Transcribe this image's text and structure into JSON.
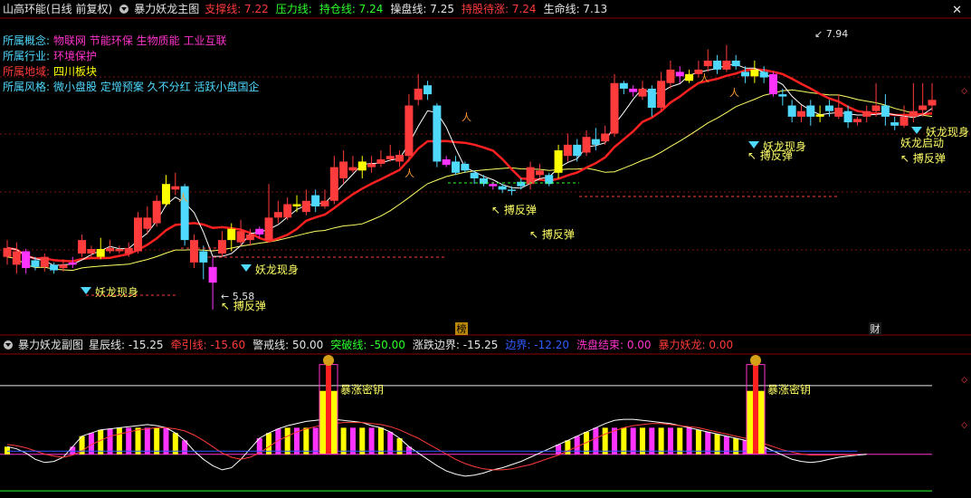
{
  "main_header": {
    "stock": "山高环能(日线 前复权)",
    "indicator": "暴力妖龙主图",
    "items": [
      {
        "label": "支撑线:",
        "value": "7.22",
        "color": "#ff3b3b"
      },
      {
        "label": "压力线:",
        "value": "",
        "color": "#2bff2b"
      },
      {
        "label": "持仓线:",
        "value": "7.24",
        "color": "#2bff2b"
      },
      {
        "label": "操盘线:",
        "value": "7.25",
        "color": "#e6e6e6"
      },
      {
        "label": "持股待涨:",
        "value": "7.24",
        "color": "#ff3b3b"
      },
      {
        "label": "生命线:",
        "value": "7.13",
        "color": "#e6e6e6"
      }
    ]
  },
  "info_panel": [
    {
      "label": "所属概念:",
      "value": "物联网 节能环保 生物质能 工业互联",
      "label_color": "#4fd9ff",
      "value_color": "#ff33cc"
    },
    {
      "label": "所属行业:",
      "value": "环境保护",
      "label_color": "#4fd9ff",
      "value_color": "#ff33cc"
    },
    {
      "label": "所属地域:",
      "value": "四川板块",
      "label_color": "#ff3b3b",
      "value_color": "#ffff00"
    },
    {
      "label": "所属风格:",
      "value": "微小盘股 定增预案 久不分红 活跃小盘国企",
      "label_color": "#4fd9ff",
      "value_color": "#4fd9ff"
    }
  ],
  "sub_header": {
    "indicator": "暴力妖龙副图",
    "items": [
      {
        "label": "星辰线:",
        "value": "-15.25",
        "color": "#e6e6e6"
      },
      {
        "label": "牵引线:",
        "value": "-15.60",
        "color": "#ff3b3b"
      },
      {
        "label": "警戒线:",
        "value": "50.00",
        "color": "#e6e6e6"
      },
      {
        "label": "突破线:",
        "value": "-50.00",
        "color": "#2bff2b"
      },
      {
        "label": "涨跌边界:",
        "value": "-15.25",
        "color": "#e6e6e6"
      },
      {
        "label": "边界:",
        "value": "-12.20",
        "color": "#2f5bff"
      },
      {
        "label": "洗盘结束:",
        "value": "0.00",
        "color": "#ff33cc"
      },
      {
        "label": "暴力妖龙:",
        "value": "0.00",
        "color": "#ff3b3b"
      }
    ]
  },
  "chart_data": [
    {
      "type": "candlestick",
      "title": "暴力妖龙主图",
      "annotations": {
        "high_label": "7.94",
        "low_label": "5.58",
        "signals": [
          "妖龙现身",
          "妖龙现身",
          "妖龙现身",
          "妖龙现身",
          "妖龙启动"
        ],
        "rebounds": [
          "搏反弹",
          "搏反弹",
          "搏反弹",
          "搏反弹",
          "搏反弹"
        ],
        "markers": [
          "榜",
          "财"
        ]
      },
      "candles": [
        {
          "o": 6.05,
          "c": 6.13,
          "h": 6.2,
          "l": 5.98
        },
        {
          "o": 5.98,
          "c": 6.1,
          "h": 6.18,
          "l": 5.9
        },
        {
          "o": 6.1,
          "c": 5.95,
          "h": 6.12,
          "l": 5.9
        },
        {
          "o": 6.02,
          "c": 5.96,
          "h": 6.05,
          "l": 5.93
        },
        {
          "o": 5.96,
          "c": 6.05,
          "h": 6.08,
          "l": 5.92
        },
        {
          "o": 5.98,
          "c": 5.93,
          "h": 6.0,
          "l": 5.9
        },
        {
          "o": 5.95,
          "c": 5.98,
          "h": 6.03,
          "l": 5.92
        },
        {
          "o": 6.0,
          "c": 5.98,
          "h": 6.05,
          "l": 5.95
        },
        {
          "o": 6.08,
          "c": 6.2,
          "h": 6.25,
          "l": 6.05
        },
        {
          "o": 6.08,
          "c": 6.12,
          "h": 6.15,
          "l": 6.05
        },
        {
          "o": 6.05,
          "c": 6.12,
          "h": 6.22,
          "l": 6.03
        },
        {
          "o": 6.1,
          "c": 6.13,
          "h": 6.2,
          "l": 6.08
        },
        {
          "o": 6.1,
          "c": 6.12,
          "h": 6.15,
          "l": 6.08
        },
        {
          "o": 6.08,
          "c": 6.13,
          "h": 6.18,
          "l": 6.05
        },
        {
          "o": 6.1,
          "c": 6.4,
          "h": 6.45,
          "l": 6.08
        },
        {
          "o": 6.3,
          "c": 6.4,
          "h": 6.5,
          "l": 6.25
        },
        {
          "o": 6.35,
          "c": 6.55,
          "h": 6.6,
          "l": 6.32
        },
        {
          "o": 6.52,
          "c": 6.7,
          "h": 6.78,
          "l": 6.5
        },
        {
          "o": 6.65,
          "c": 6.68,
          "h": 6.8,
          "l": 6.6
        },
        {
          "o": 6.68,
          "c": 6.2,
          "h": 6.7,
          "l": 6.15
        },
        {
          "o": 6.0,
          "c": 6.2,
          "h": 6.25,
          "l": 5.95
        },
        {
          "o": 6.1,
          "c": 6.0,
          "h": 6.15,
          "l": 5.85
        },
        {
          "o": 5.96,
          "c": 5.82,
          "h": 6.05,
          "l": 5.58
        },
        {
          "o": 6.08,
          "c": 6.2,
          "h": 6.28,
          "l": 6.05
        },
        {
          "o": 6.2,
          "c": 6.3,
          "h": 6.35,
          "l": 6.1
        },
        {
          "o": 6.18,
          "c": 6.28,
          "h": 6.38,
          "l": 6.15
        },
        {
          "o": 6.2,
          "c": 6.25,
          "h": 6.3,
          "l": 6.15
        },
        {
          "o": 6.3,
          "c": 6.25,
          "h": 6.32,
          "l": 6.22
        },
        {
          "o": 6.2,
          "c": 6.4,
          "h": 6.7,
          "l": 6.18
        },
        {
          "o": 6.4,
          "c": 6.45,
          "h": 6.55,
          "l": 6.35
        },
        {
          "o": 6.4,
          "c": 6.52,
          "h": 6.58,
          "l": 6.38
        },
        {
          "o": 6.5,
          "c": 6.52,
          "h": 6.6,
          "l": 6.45
        },
        {
          "o": 6.45,
          "c": 6.55,
          "h": 6.65,
          "l": 6.42
        },
        {
          "o": 6.6,
          "c": 6.5,
          "h": 6.65,
          "l": 6.45
        },
        {
          "o": 6.5,
          "c": 6.55,
          "h": 6.65,
          "l": 6.48
        },
        {
          "o": 6.55,
          "c": 6.85,
          "h": 6.95,
          "l": 6.52
        },
        {
          "o": 6.75,
          "c": 6.9,
          "h": 7.0,
          "l": 6.7
        },
        {
          "o": 6.82,
          "c": 6.85,
          "h": 6.95,
          "l": 6.8
        },
        {
          "o": 6.82,
          "c": 6.9,
          "h": 6.95,
          "l": 6.75
        },
        {
          "o": 6.85,
          "c": 6.88,
          "h": 6.95,
          "l": 6.8
        },
        {
          "o": 6.88,
          "c": 6.92,
          "h": 7.0,
          "l": 6.85
        },
        {
          "o": 6.92,
          "c": 6.95,
          "h": 7.05,
          "l": 6.9
        },
        {
          "o": 6.9,
          "c": 6.96,
          "h": 7.0,
          "l": 6.85
        },
        {
          "o": 6.95,
          "c": 7.4,
          "h": 7.5,
          "l": 6.9
        },
        {
          "o": 7.45,
          "c": 7.55,
          "h": 7.68,
          "l": 7.4
        },
        {
          "o": 7.58,
          "c": 7.5,
          "h": 7.62,
          "l": 7.45
        },
        {
          "o": 7.4,
          "c": 6.9,
          "h": 7.42,
          "l": 6.85
        },
        {
          "o": 6.92,
          "c": 6.87,
          "h": 6.95,
          "l": 6.85
        },
        {
          "o": 6.9,
          "c": 6.8,
          "h": 6.95,
          "l": 6.78
        },
        {
          "o": 6.88,
          "c": 6.82,
          "h": 6.9,
          "l": 6.8
        },
        {
          "o": 6.8,
          "c": 6.75,
          "h": 6.82,
          "l": 6.7
        },
        {
          "o": 6.75,
          "c": 6.7,
          "h": 6.78,
          "l": 6.68
        },
        {
          "o": 6.7,
          "c": 6.68,
          "h": 6.72,
          "l": 6.65
        },
        {
          "o": 6.68,
          "c": 6.65,
          "h": 6.7,
          "l": 6.62
        },
        {
          "o": 6.65,
          "c": 6.64,
          "h": 6.68,
          "l": 6.6
        },
        {
          "o": 6.72,
          "c": 6.68,
          "h": 6.75,
          "l": 6.65
        },
        {
          "o": 6.7,
          "c": 6.85,
          "h": 6.9,
          "l": 6.65
        },
        {
          "o": 6.78,
          "c": 6.82,
          "h": 6.88,
          "l": 6.75
        },
        {
          "o": 6.78,
          "c": 6.7,
          "h": 6.8,
          "l": 6.68
        },
        {
          "o": 6.8,
          "c": 7.0,
          "h": 7.05,
          "l": 6.75
        },
        {
          "o": 6.95,
          "c": 7.05,
          "h": 7.15,
          "l": 6.9
        },
        {
          "o": 7.05,
          "c": 6.95,
          "h": 7.1,
          "l": 6.9
        },
        {
          "o": 6.98,
          "c": 7.12,
          "h": 7.18,
          "l": 6.95
        },
        {
          "o": 7.1,
          "c": 7.05,
          "h": 7.2,
          "l": 7.0
        },
        {
          "o": 7.08,
          "c": 7.15,
          "h": 7.22,
          "l": 7.05
        },
        {
          "o": 7.15,
          "c": 7.6,
          "h": 7.68,
          "l": 7.12
        },
        {
          "o": 7.6,
          "c": 7.55,
          "h": 7.62,
          "l": 7.5
        },
        {
          "o": 7.55,
          "c": 7.52,
          "h": 7.58,
          "l": 7.48
        },
        {
          "o": 7.48,
          "c": 7.55,
          "h": 7.62,
          "l": 7.45
        },
        {
          "o": 7.55,
          "c": 7.38,
          "h": 7.58,
          "l": 7.3
        },
        {
          "o": 7.38,
          "c": 7.62,
          "h": 7.7,
          "l": 7.35
        },
        {
          "o": 7.6,
          "c": 7.72,
          "h": 7.8,
          "l": 7.55
        },
        {
          "o": 7.7,
          "c": 7.66,
          "h": 7.75,
          "l": 7.6
        },
        {
          "o": 7.62,
          "c": 7.68,
          "h": 7.72,
          "l": 7.6
        },
        {
          "o": 7.68,
          "c": 7.72,
          "h": 7.8,
          "l": 7.65
        },
        {
          "o": 7.75,
          "c": 7.8,
          "h": 7.9,
          "l": 7.7
        },
        {
          "o": 7.8,
          "c": 7.72,
          "h": 7.85,
          "l": 7.68
        },
        {
          "o": 7.72,
          "c": 7.8,
          "h": 7.94,
          "l": 7.7
        },
        {
          "o": 7.8,
          "c": 7.75,
          "h": 7.85,
          "l": 7.72
        },
        {
          "o": 7.7,
          "c": 7.66,
          "h": 7.75,
          "l": 7.6
        },
        {
          "o": 7.66,
          "c": 7.72,
          "h": 7.8,
          "l": 7.6
        },
        {
          "o": 7.7,
          "c": 7.65,
          "h": 7.75,
          "l": 7.6
        },
        {
          "o": 7.68,
          "c": 7.5,
          "h": 7.7,
          "l": 7.48
        },
        {
          "o": 7.5,
          "c": 7.48,
          "h": 7.55,
          "l": 7.4
        },
        {
          "o": 7.4,
          "c": 7.3,
          "h": 7.45,
          "l": 7.25
        },
        {
          "o": 7.3,
          "c": 7.35,
          "h": 7.4,
          "l": 7.25
        },
        {
          "o": 7.4,
          "c": 7.3,
          "h": 7.45,
          "l": 7.22
        },
        {
          "o": 7.3,
          "c": 7.32,
          "h": 7.4,
          "l": 7.25
        },
        {
          "o": 7.4,
          "c": 7.35,
          "h": 7.45,
          "l": 7.3
        },
        {
          "o": 7.3,
          "c": 7.38,
          "h": 7.5,
          "l": 7.28
        },
        {
          "o": 7.35,
          "c": 7.25,
          "h": 7.4,
          "l": 7.2
        },
        {
          "o": 7.25,
          "c": 7.28,
          "h": 7.3,
          "l": 7.22
        },
        {
          "o": 7.3,
          "c": 7.35,
          "h": 7.4,
          "l": 7.25
        },
        {
          "o": 7.35,
          "c": 7.4,
          "h": 7.6,
          "l": 7.3
        },
        {
          "o": 7.4,
          "c": 7.3,
          "h": 7.5,
          "l": 7.22
        },
        {
          "o": 7.25,
          "c": 7.22,
          "h": 7.3,
          "l": 7.18
        },
        {
          "o": 7.22,
          "c": 7.3,
          "h": 7.4,
          "l": 7.2
        },
        {
          "o": 7.3,
          "c": 7.35,
          "h": 7.6,
          "l": 7.25
        },
        {
          "o": 7.36,
          "c": 7.4,
          "h": 7.6,
          "l": 7.3
        },
        {
          "o": 7.4,
          "c": 7.45,
          "h": 7.6,
          "l": 7.35
        }
      ]
    },
    {
      "type": "line",
      "title": "暴力妖龙副图",
      "series": [
        {
          "name": "星辰线",
          "color": "#ffffff",
          "values": [
            -8,
            -10,
            -14,
            -20,
            -23,
            -22,
            -18,
            -8,
            2,
            5,
            8,
            9,
            10,
            11,
            12,
            13,
            12,
            10,
            5,
            -2,
            -12,
            -20,
            -26,
            -30,
            -28,
            -20,
            -10,
            0,
            5,
            9,
            12,
            14,
            16,
            17,
            18,
            18,
            17,
            16,
            15,
            12,
            10,
            6,
            0,
            -8,
            -14,
            -20,
            -26,
            -31,
            -34,
            -36,
            -35,
            -33,
            -30,
            -28,
            -25,
            -22,
            -18,
            -14,
            -10,
            -6,
            -2,
            2,
            6,
            10,
            14,
            17,
            18,
            18,
            17,
            16,
            15,
            14,
            12,
            10,
            8,
            6,
            4,
            2,
            0,
            -2,
            -5,
            -8,
            -12,
            -16,
            -20,
            -22,
            -23,
            -22,
            -20,
            -18,
            -17,
            -16,
            -15.25
          ]
        },
        {
          "name": "牵引线",
          "color": "#ff3b3b",
          "values": [
            -6,
            -7,
            -9,
            -12,
            -15,
            -17,
            -18,
            -16,
            -12,
            -6,
            -2,
            2,
            4,
            6,
            8,
            9,
            10,
            10,
            9,
            7,
            3,
            -2,
            -8,
            -14,
            -18,
            -20,
            -18,
            -14,
            -8,
            -2,
            2,
            6,
            9,
            11,
            13,
            14,
            15,
            15,
            15,
            14,
            13,
            11,
            8,
            4,
            0,
            -5,
            -10,
            -15,
            -20,
            -24,
            -27,
            -29,
            -30,
            -30,
            -29,
            -27,
            -25,
            -22,
            -19,
            -16,
            -12,
            -8,
            -4,
            0,
            4,
            7,
            10,
            12,
            13,
            14,
            14,
            13,
            12,
            11,
            10,
            8,
            6,
            4,
            2,
            0,
            -2,
            -5,
            -8,
            -11,
            -13,
            -15,
            -16,
            -16,
            -16,
            -15.8,
            -15.7,
            -15.6
          ]
        },
        {
          "name": "边界",
          "color": "#2f5bff",
          "values": [
            -12.2,
            -12.2,
            -12.2,
            -12.2,
            -12.2,
            -12.2,
            -12.2,
            -12.2,
            -12.2,
            -12.2,
            -12.2,
            -12.2,
            -12.2,
            -12.2,
            -12.2,
            -12.2,
            -12.2,
            -12.2,
            -12.2,
            -12.2,
            -12.2,
            -12.2,
            -12.2,
            -12.2,
            -12.2,
            -12.2,
            -12.2,
            -12.2,
            -12.2,
            -12.2,
            -12.2,
            -12.2,
            -12.2,
            -12.2,
            -12.2,
            -12.2,
            -12.2,
            -12.2,
            -12.2,
            -12.2,
            -12.2,
            -12.2,
            -12.2,
            -12.2,
            -12.2,
            -12.2,
            -12.2,
            -12.2,
            -12.2,
            -12.2,
            -12.2,
            -12.2,
            -12.2,
            -12.2,
            -12.2,
            -12.2,
            -12.2,
            -12.2,
            -12.2,
            -12.2,
            -12.2,
            -12.2,
            -12.2,
            -12.2,
            -12.2,
            -12.2,
            -12.2,
            -12.2,
            -12.2,
            -12.2,
            -12.2,
            -12.2,
            -12.2,
            -12.2,
            -12.2,
            -12.2,
            -12.2,
            -12.2,
            -12.2,
            -12.2,
            -12.2,
            -12.2,
            -12.2,
            -12.2,
            -12.2,
            -12.2,
            -12.2,
            -12.2,
            -12.2,
            -12.2,
            -12.2,
            -12.2
          ]
        }
      ],
      "reference_lines": [
        {
          "name": "警戒线",
          "value": 50,
          "color": "#e6e6e6"
        },
        {
          "name": "涨跌边界",
          "value": -15.25,
          "color": "#ff33cc"
        },
        {
          "name": "突破线",
          "value": -50,
          "color": "#2bff2b"
        }
      ],
      "signal_text": "暴涨密钥",
      "ylim": [
        -55,
        80
      ]
    }
  ]
}
